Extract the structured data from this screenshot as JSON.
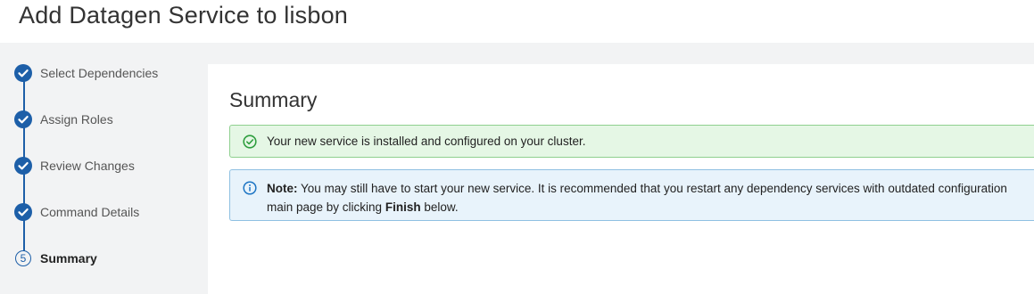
{
  "page": {
    "title": "Add Datagen Service to lisbon"
  },
  "wizard": {
    "steps": [
      {
        "label": "Select Dependencies",
        "state": "completed",
        "icon": "check-circle-icon"
      },
      {
        "label": "Assign Roles",
        "state": "completed",
        "icon": "check-circle-icon"
      },
      {
        "label": "Review Changes",
        "state": "completed",
        "icon": "check-circle-icon"
      },
      {
        "label": "Command Details",
        "state": "completed",
        "icon": "check-circle-icon"
      },
      {
        "label": "Summary",
        "state": "current",
        "number": "5"
      }
    ]
  },
  "summary": {
    "title": "Summary",
    "success_message": "Your new service is installed and configured on your cluster.",
    "note_label": "Note:",
    "note_text_1": " You may still have to start your new service. It is recommended that you restart any dependency services with outdated configuration",
    "note_text_2_pre": "main page by clicking ",
    "note_finish": "Finish",
    "note_text_2_post": " below."
  },
  "colors": {
    "accent": "#1d5fa8",
    "success_bg": "#e5f7e5",
    "success_border": "#8fd08f",
    "success_icon": "#2e9e3e",
    "info_bg": "#e8f3fb",
    "info_border": "#8fc0e2",
    "info_icon": "#1d75c4",
    "sidebar_bg": "#f2f3f4"
  }
}
